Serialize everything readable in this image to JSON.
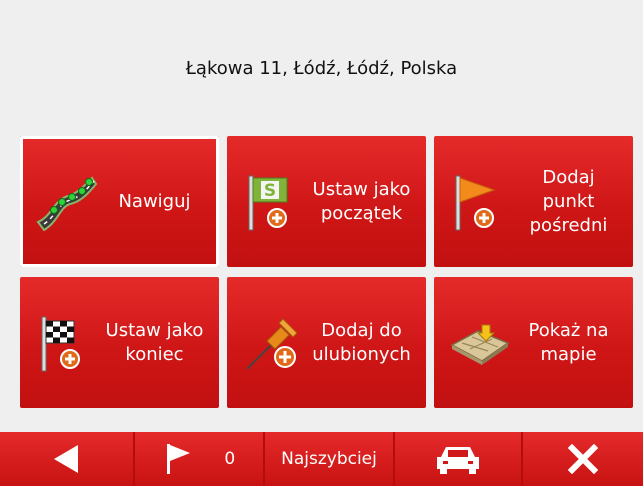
{
  "address": "Łąkowa 11, Łódź, Łódź, Polska",
  "tiles": [
    {
      "label": "Nawiguj",
      "icon": "road-icon"
    },
    {
      "label": "Ustaw jako\npoczątek",
      "icon": "start-flag-icon",
      "badge": "S"
    },
    {
      "label": "Dodaj\npunkt\npośredni",
      "icon": "waypoint-flag-icon"
    },
    {
      "label": "Ustaw jako\nkoniec",
      "icon": "finish-flag-icon"
    },
    {
      "label": "Dodaj do\nulubionych",
      "icon": "pushpin-icon"
    },
    {
      "label": "Pokaż na\nmapie",
      "icon": "map-icon"
    }
  ],
  "bottom_bar": {
    "back_icon": "back-arrow-icon",
    "waypoint_icon": "flag-icon",
    "waypoint_count": "0",
    "route_mode": "Najszybciej",
    "vehicle_icon": "car-icon",
    "close_icon": "close-icon"
  },
  "colors": {
    "tile_red": "#d81c1c",
    "background": "#efefef"
  }
}
